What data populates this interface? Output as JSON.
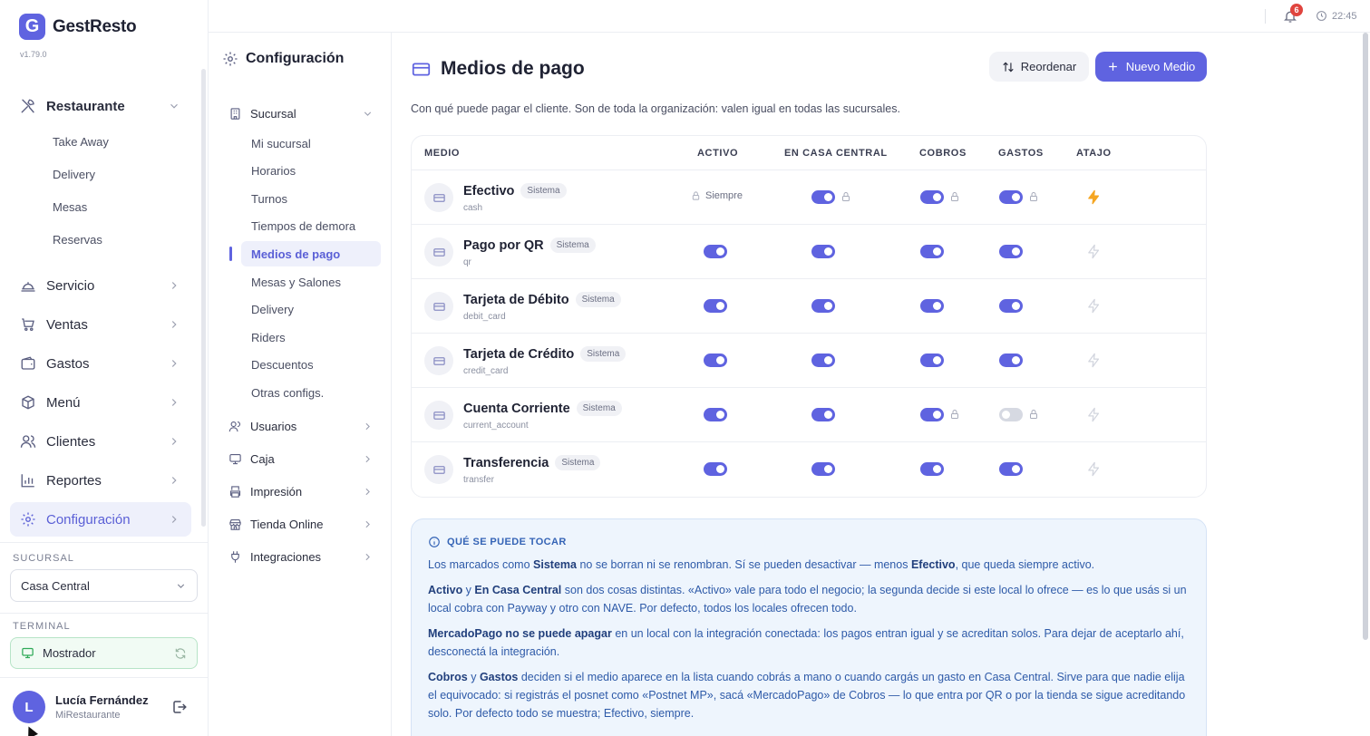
{
  "app": {
    "name": "GestResto",
    "logo_letter": "G",
    "version": "v1.79.0",
    "accent": "#5f63e0"
  },
  "sidebar": {
    "items": [
      {
        "label": "Restaurante",
        "icon": "utensils-icon",
        "expanded": true
      },
      {
        "label": "Servicio",
        "icon": "cloche-icon"
      },
      {
        "label": "Ventas",
        "icon": "cart-icon"
      },
      {
        "label": "Gastos",
        "icon": "wallet-icon"
      },
      {
        "label": "Menú",
        "icon": "box-icon"
      },
      {
        "label": "Clientes",
        "icon": "users-icon"
      },
      {
        "label": "Reportes",
        "icon": "chart-icon"
      },
      {
        "label": "Configuración",
        "icon": "gear-icon",
        "active": true
      }
    ],
    "restaurante_sub": [
      "Take Away",
      "Delivery",
      "Mesas",
      "Reservas"
    ],
    "sucursal_label": "SUCURSAL",
    "sucursal_value": "Casa Central",
    "terminal_label": "TERMINAL",
    "terminal_value": "Mostrador",
    "user": {
      "initial": "L",
      "name": "Lucía Fernández",
      "org": "MiRestaurante"
    }
  },
  "topbar": {
    "notifications": "6",
    "time": "22:45"
  },
  "config": {
    "title": "Configuración",
    "groups": [
      {
        "label": "Sucursal",
        "icon": "building-icon",
        "expanded": true
      },
      {
        "label": "Usuarios",
        "icon": "users-icon"
      },
      {
        "label": "Caja",
        "icon": "monitor-icon"
      },
      {
        "label": "Impresión",
        "icon": "printer-icon"
      },
      {
        "label": "Tienda Online",
        "icon": "store-icon"
      },
      {
        "label": "Integraciones",
        "icon": "plug-icon"
      }
    ],
    "sucursal_items": [
      "Mi sucursal",
      "Horarios",
      "Turnos",
      "Tiempos de demora",
      "Medios de pago",
      "Mesas y Salones",
      "Delivery",
      "Riders",
      "Descuentos",
      "Otras configs."
    ],
    "active_item": "Medios de pago"
  },
  "main": {
    "title": "Medios de pago",
    "reorder_label": "Reordenar",
    "new_label": "Nuevo Medio",
    "description": "Con qué puede pagar el cliente. Son de toda la organización: valen igual en todas las sucursales.",
    "columns": [
      "MEDIO",
      "ACTIVO",
      "EN CASA CENTRAL",
      "COBROS",
      "GASTOS",
      "ATAJO"
    ],
    "system_tag": "Sistema",
    "always_label": "Siempre",
    "rows": [
      {
        "name": "Efectivo",
        "code": "cash",
        "activo": "always",
        "casa_central": true,
        "casa_locked": true,
        "cobros": true,
        "cobros_locked": true,
        "gastos": true,
        "gastos_locked": true,
        "atajo": true
      },
      {
        "name": "Pago por QR",
        "code": "qr",
        "activo": true,
        "casa_central": true,
        "cobros": true,
        "gastos": true,
        "atajo": false
      },
      {
        "name": "Tarjeta de Débito",
        "code": "debit_card",
        "activo": true,
        "casa_central": true,
        "cobros": true,
        "gastos": true,
        "atajo": false
      },
      {
        "name": "Tarjeta de Crédito",
        "code": "credit_card",
        "activo": true,
        "casa_central": true,
        "cobros": true,
        "gastos": true,
        "atajo": false
      },
      {
        "name": "Cuenta Corriente",
        "code": "current_account",
        "activo": true,
        "casa_central": true,
        "cobros": true,
        "cobros_locked": true,
        "gastos": false,
        "gastos_locked": true,
        "atajo": false
      },
      {
        "name": "Transferencia",
        "code": "transfer",
        "activo": true,
        "casa_central": true,
        "cobros": true,
        "gastos": true,
        "atajo": false
      }
    ],
    "info": {
      "title": "QUÉ SE PUEDE TOCAR",
      "p1": [
        "Los marcados como ",
        "Sistema",
        " no se borran ni se renombran. Sí se pueden desactivar — menos ",
        "Efectivo",
        ", que queda siempre activo."
      ],
      "p2": [
        "Activo",
        " y ",
        "En Casa Central",
        " son dos cosas distintas. «Activo» vale para todo el negocio; la segunda decide si este local lo ofrece — es lo que usás si un local cobra con Payway y otro con NAVE. Por defecto, todos los locales ofrecen todo."
      ],
      "p3": [
        "MercadoPago no se puede apagar",
        " en un local con la integración conectada: los pagos entran igual y se acreditan solos. Para dejar de aceptarlo ahí, desconectá la integración."
      ],
      "p4": [
        "Cobros",
        " y ",
        "Gastos",
        " deciden si el medio aparece en la lista cuando cobrás a mano o cuando cargás un gasto en Casa Central. Sirve para que nadie elija el equivocado: si registrás el posnet como «Postnet MP», sacá «MercadoPago» de Cobros — lo que entra por QR o por la tienda se sigue acreditando solo. Por defecto todo se muestra; Efectivo, siempre."
      ]
    }
  }
}
